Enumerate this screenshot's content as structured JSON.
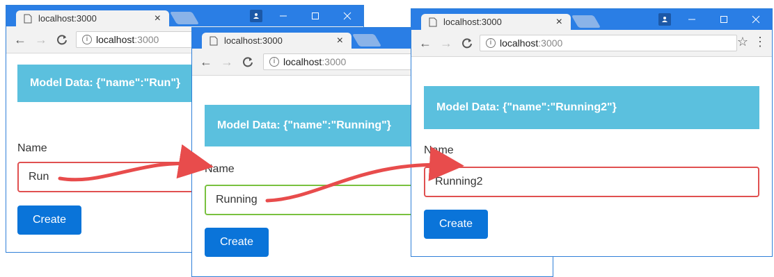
{
  "colors": {
    "titlebar": "#2a7ee5",
    "model_box": "#5bc0de",
    "button": "#0a74d9",
    "invalid_border": "#e05050",
    "valid_border": "#79c13f",
    "arrow": "#e84c4c"
  },
  "icons": {
    "page": "page-icon",
    "close": "close-icon",
    "user": "user-icon",
    "minimize": "minimize-icon",
    "maximize": "maximize-icon",
    "window_close": "window-close-icon",
    "back": "back-arrow-icon",
    "forward": "forward-arrow-icon",
    "reload": "reload-icon",
    "info": "info-icon",
    "star": "star-icon",
    "menu": "menu-dots-icon"
  },
  "windows": [
    {
      "tab_title": "localhost:3000",
      "url_host": "localhost",
      "url_port": ":3000",
      "model_data": "Model Data: {\"name\":\"Run\"}",
      "name_label": "Name",
      "input_value": "Run",
      "input_state": "invalid",
      "create_label": "Create"
    },
    {
      "tab_title": "localhost:3000",
      "url_host": "localhost",
      "url_port": ":3000",
      "model_data": "Model Data: {\"name\":\"Running\"}",
      "name_label": "Name",
      "input_value": "Running",
      "input_state": "valid",
      "create_label": "Create"
    },
    {
      "tab_title": "localhost:3000",
      "url_host": "localhost",
      "url_port": ":3000",
      "model_data": "Model Data: {\"name\":\"Running2\"}",
      "name_label": "Name",
      "input_value": "Running2",
      "input_state": "invalid",
      "create_label": "Create"
    }
  ]
}
